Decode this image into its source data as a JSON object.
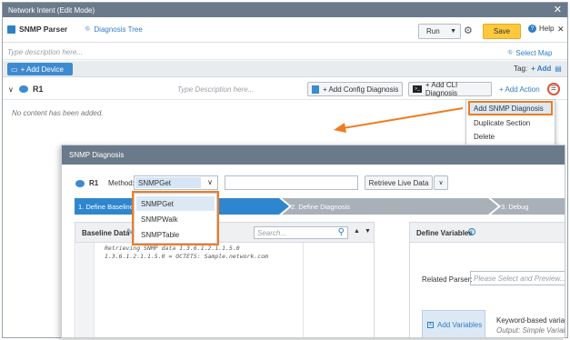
{
  "window": {
    "title": "Network Intent (Edit Mode)",
    "close": "✕"
  },
  "toolbar": {
    "app_name": "SNMP Parser",
    "tree_link": "Diagnosis Tree",
    "run_label": "Run",
    "save_label": "Save",
    "help_label": "Help",
    "description_placeholder": "Type description here...",
    "select_map": "Select Map",
    "add_device": "+ Add Device",
    "tag_label": "Tag:",
    "tag_add": "+ Add"
  },
  "device": {
    "name": "R1",
    "desc_placeholder": "Type Description here...",
    "add_config": "+ Add Config Diagnosis",
    "add_cli": "+ Add CLI Diagnosis",
    "add_action": "+ Add Action",
    "empty_text": "No content has been added."
  },
  "context_menu": {
    "items": [
      "Add SNMP Diagnosis",
      "Duplicate Section",
      "Delete"
    ]
  },
  "snmp": {
    "title": "SNMP Diagnosis",
    "device": "R1",
    "method_label": "Method:",
    "method_value": "SNMPGet",
    "retrieve_label": "Retrieve Live Data",
    "method_options": [
      "SNMPGet",
      "SNMPWalk",
      "SNMPTable"
    ],
    "steps": [
      "1. Define Baseline",
      "2. Define Diagnosis",
      "3. Debug"
    ],
    "baseline_title": "Baseline Data",
    "search_placeholder": "Search...",
    "code_lines": [
      "Retrieving SNMP data 1.3.6.1.2.1.1.5.0",
      "1.3.6.1.2.1.1.5.0 = OCTETS: Sample.network.com"
    ],
    "define_vars_title": "Define Variables",
    "related_parser_label": "Related Parser:",
    "related_parser_placeholder": "Please Select and Preview...",
    "add_variables": "Add Variables",
    "keyword_title": "Keyword-based varia",
    "output_text": "Output: Simple Variab"
  },
  "colors": {
    "accent_orange": "#f07b22",
    "save_bg": "#ffc83d",
    "step_blue": "#2f86cf",
    "step_gray": "#a9b0b8",
    "title_gray": "#6b7a8a"
  }
}
